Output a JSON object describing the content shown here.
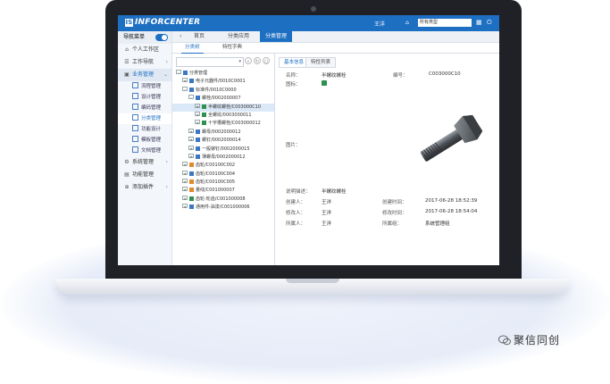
{
  "app": {
    "brand": "INFORCENTER",
    "brand_mark": "IS",
    "user": "王洋",
    "header_select": "所有类型",
    "icons": [
      "bell-icon",
      "grid-icon",
      "power-icon"
    ]
  },
  "sidebar": {
    "top_label": "导航菜单",
    "items": [
      {
        "label": "个人工作区",
        "icon": "home-icon"
      },
      {
        "label": "工作导航",
        "icon": "list-icon"
      },
      {
        "label": "业务管理",
        "icon": "briefcase-icon",
        "open": true
      }
    ],
    "subitems": [
      {
        "label": "流程管理"
      },
      {
        "label": "设计管理"
      },
      {
        "label": "编码管理"
      },
      {
        "label": "分类管理",
        "active": true
      },
      {
        "label": "功能设计"
      },
      {
        "label": "模板管理"
      },
      {
        "label": "文档管理"
      }
    ],
    "bottom_items": [
      {
        "label": "系统管理",
        "icon": "settings-icon"
      },
      {
        "label": "功能管理",
        "icon": "function-icon"
      },
      {
        "label": "添加插件",
        "icon": "plus-icon"
      }
    ]
  },
  "tabs": [
    {
      "label": "首页"
    },
    {
      "label": "分类应用"
    },
    {
      "label": "分类管理",
      "active": true
    }
  ],
  "subtabs": [
    {
      "label": "分类树",
      "active": true
    },
    {
      "label": "特性字典"
    }
  ],
  "tree": {
    "root": "分类管理",
    "nodes": [
      {
        "label": "电子元器件/0010C0001",
        "indent": 1,
        "exp": "+"
      },
      {
        "label": "标准件/0010C0000",
        "indent": 1,
        "exp": "-"
      },
      {
        "label": "螺栓/0002000007",
        "indent": 2,
        "exp": "-"
      },
      {
        "label": "半螺纹螺栓/C003000C10",
        "indent": 3,
        "exp": "+",
        "selected": true
      },
      {
        "label": "全螺纹/0003000011",
        "indent": 3,
        "exp": "+"
      },
      {
        "label": "十字槽螺栓/C003000012",
        "indent": 3,
        "exp": "+"
      },
      {
        "label": "螺母/0002000012",
        "indent": 2,
        "exp": "+"
      },
      {
        "label": "螺钉/0002000014",
        "indent": 2,
        "exp": "+"
      },
      {
        "label": "一般铆钉/0002000015",
        "indent": 2,
        "exp": "+"
      },
      {
        "label": "薄螺母/0002000012",
        "indent": 2,
        "exp": "+"
      },
      {
        "label": "齿轮/C00100C002",
        "indent": 1,
        "exp": "+"
      },
      {
        "label": "齿轮/C00100C004",
        "indent": 1,
        "exp": "+"
      },
      {
        "label": "齿轮/C00100C005",
        "indent": 1,
        "exp": "+"
      },
      {
        "label": "量线/C001000007",
        "indent": 1,
        "exp": "+"
      },
      {
        "label": "齿轮-轮齿/C001000008",
        "indent": 1,
        "exp": "+"
      },
      {
        "label": "通用件-油漆/C001000006",
        "indent": 1,
        "exp": "+"
      }
    ]
  },
  "detail": {
    "tabs": [
      {
        "label": "基本信息",
        "active": true
      },
      {
        "label": "特性列表"
      }
    ],
    "name_label": "名称：",
    "name_value": "半螺纹螺栓",
    "code_label": "编号：",
    "code_value": "C003000C10",
    "icon_label": "图标：",
    "image_label": "图片：",
    "desc_label": "说明描述：",
    "desc_value": "半螺纹螺栓",
    "creator_label": "创建人：",
    "creator_value": "王洋",
    "created_label": "创建时间：",
    "created_value": "2017-06-28 18:52:39",
    "modifier_label": "修改人：",
    "modifier_value": "王洋",
    "modified_label": "修改时间：",
    "modified_value": "2017-06-28 18:54:04",
    "owner_label": "所属人：",
    "owner_value": "王洋",
    "group_label": "所属组：",
    "group_value": "系统管理组"
  },
  "watermark": "聚信同创"
}
